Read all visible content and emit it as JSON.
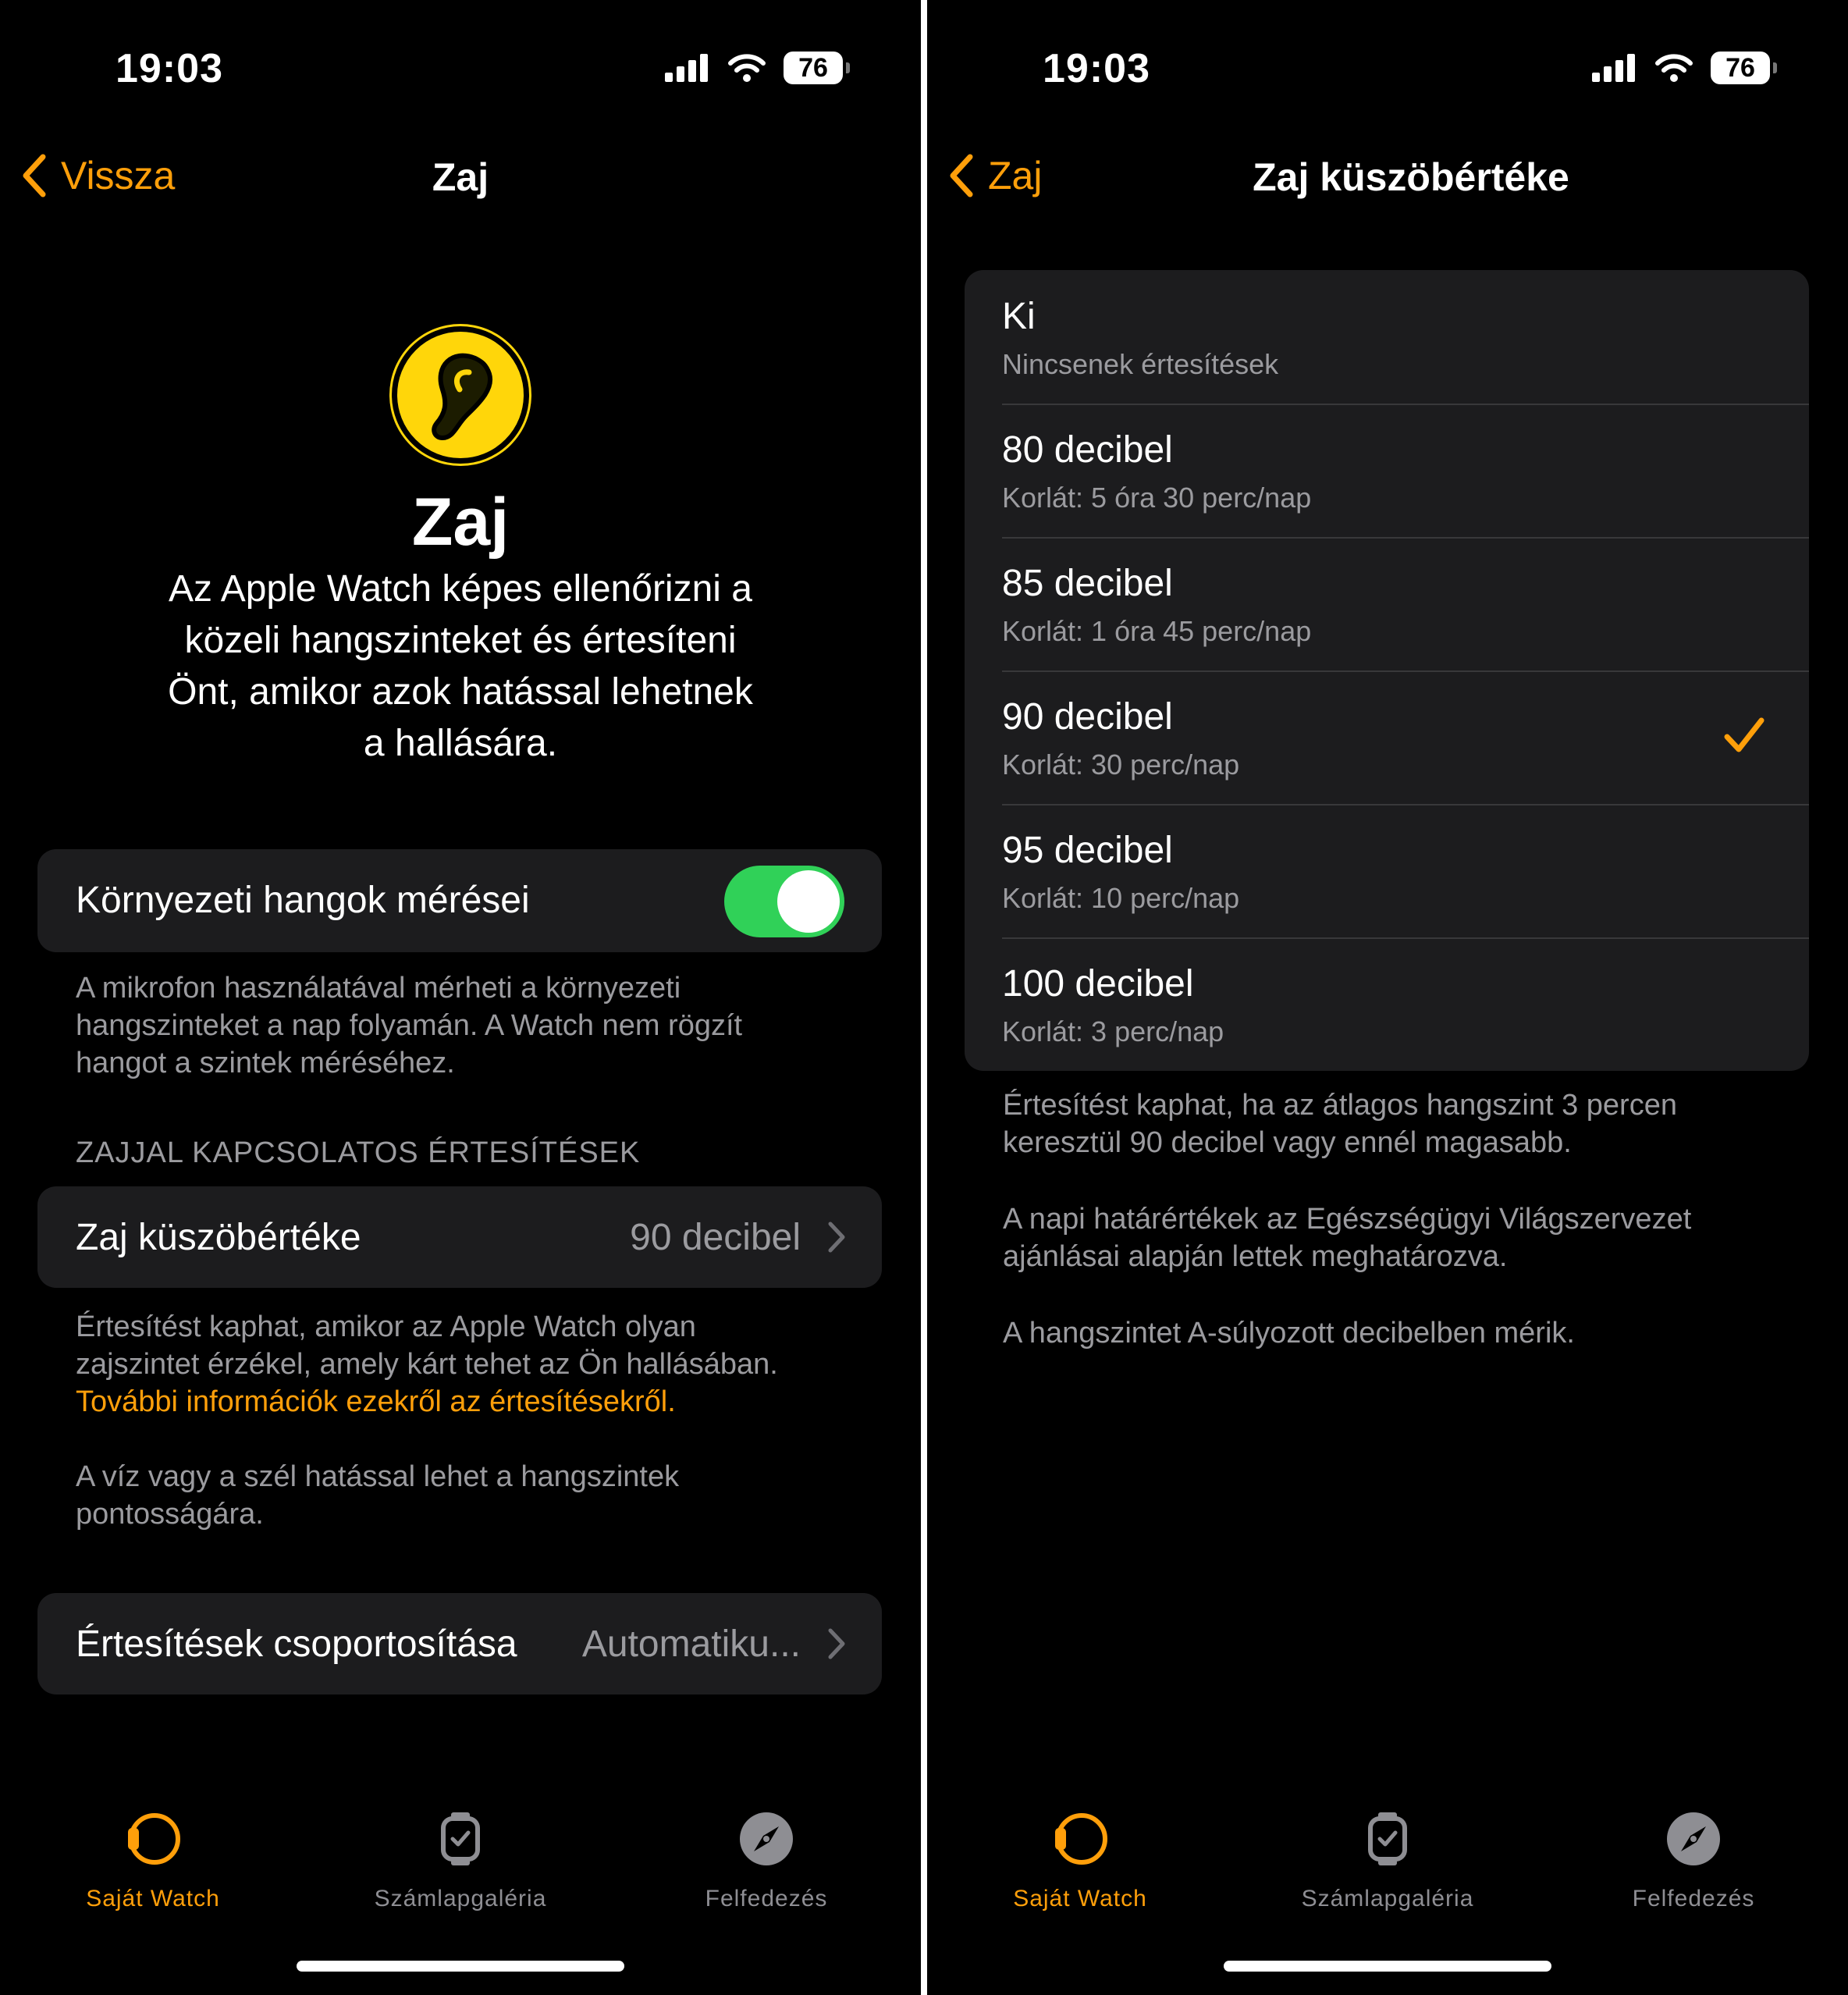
{
  "status_bar": {
    "time": "19:03",
    "battery": "76"
  },
  "colors": {
    "accent": "#ff9f0a",
    "toggle_on": "#30d158",
    "hero_icon": "#ffd60a",
    "group_bg": "#1c1c1e"
  },
  "left": {
    "nav": {
      "back_label": "Vissza",
      "title": "Zaj"
    },
    "hero": {
      "icon": "ear-icon",
      "title": "Zaj",
      "desc_lines": [
        "Az Apple Watch képes ellenőrizni a",
        "közeli hangszinteket és értesíteni",
        "Önt, amikor azok hatással lehetnek",
        "a hallására."
      ]
    },
    "measurement": {
      "label": "Környezeti hangok mérései",
      "enabled": true
    },
    "measurement_footer": [
      "A mikrofon használatával mérheti a környezeti",
      "hangszinteket a nap folyamán. A Watch nem rögzít",
      "hangot a szintek méréséhez."
    ],
    "section_header": "ZAJJAL KAPCSOLATOS ÉRTESÍTÉSEK",
    "threshold_row": {
      "label": "Zaj küszöbértéke",
      "value": "90 decibel"
    },
    "threshold_footer": [
      "Értesítést kaphat, amikor az Apple Watch olyan",
      "zajszintet érzékel, amely kárt tehet az Ön hallásában."
    ],
    "threshold_link": "További információk ezekről az értesítésekről.",
    "wind_footer": [
      "A víz vagy a szél hatással lehet a hangszintek",
      "pontosságára."
    ],
    "grouping_row": {
      "label": "Értesítések csoportosítása",
      "value": "Automatiku..."
    }
  },
  "right": {
    "nav": {
      "back_label": "Zaj",
      "title": "Zaj küszöbértéke"
    },
    "options": [
      {
        "title": "Ki",
        "subtitle": "Nincsenek értesítések",
        "selected": false
      },
      {
        "title": "80 decibel",
        "subtitle": "Korlát: 5 óra 30 perc/nap",
        "selected": false
      },
      {
        "title": "85 decibel",
        "subtitle": "Korlát: 1 óra 45 perc/nap",
        "selected": false
      },
      {
        "title": "90 decibel",
        "subtitle": "Korlát: 30 perc/nap",
        "selected": true
      },
      {
        "title": "95 decibel",
        "subtitle": "Korlát: 10 perc/nap",
        "selected": false
      },
      {
        "title": "100 decibel",
        "subtitle": "Korlát: 3 perc/nap",
        "selected": false
      }
    ],
    "footer1": [
      "Értesítést kaphat, ha az átlagos hangszint 3 percen",
      "keresztül 90 decibel vagy ennél magasabb."
    ],
    "footer2": [
      "A napi határértékek az Egészségügyi Világszervezet",
      "ajánlásai alapján lettek meghatározva."
    ],
    "footer3": "A hangszintet A-súlyozott decibelben mérik."
  },
  "tabbar": {
    "tabs": [
      {
        "label": "Saját Watch",
        "icon": "watch-icon",
        "active": true
      },
      {
        "label": "Számlapgaléria",
        "icon": "watch-face-icon",
        "active": false
      },
      {
        "label": "Felfedezés",
        "icon": "compass-icon",
        "active": false
      }
    ]
  }
}
